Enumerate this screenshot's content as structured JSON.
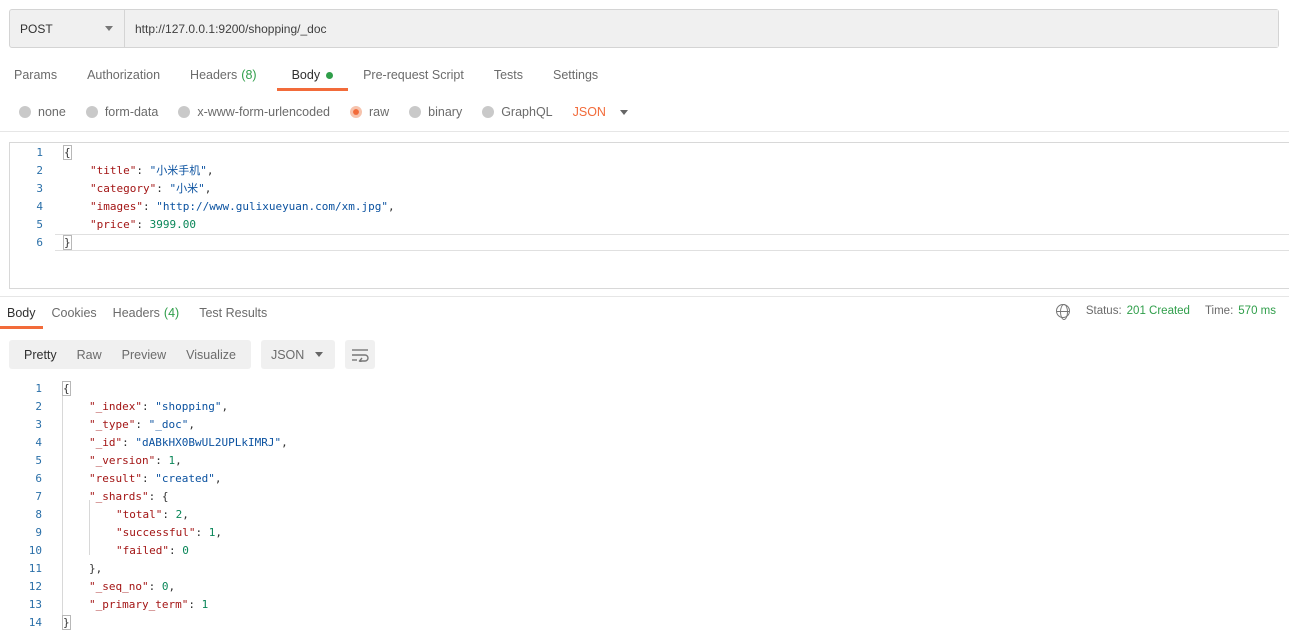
{
  "request": {
    "method": "POST",
    "url": "http://127.0.0.1:9200/shopping/_doc"
  },
  "request_tabs": [
    {
      "label": "Params",
      "count": ""
    },
    {
      "label": "Authorization",
      "count": ""
    },
    {
      "label": "Headers",
      "count": "(8)"
    },
    {
      "label": "Body",
      "count": "",
      "active": true
    },
    {
      "label": "Pre-request Script",
      "count": ""
    },
    {
      "label": "Tests",
      "count": ""
    },
    {
      "label": "Settings",
      "count": ""
    }
  ],
  "body_types": [
    "none",
    "form-data",
    "x-www-form-urlencoded",
    "raw",
    "binary",
    "GraphQL"
  ],
  "body_type_selected": "raw",
  "body_language": "JSON",
  "request_body": {
    "line_numbers": [
      "1",
      "2",
      "3",
      "4",
      "5",
      "6"
    ],
    "open_brace": "{",
    "close_brace": "}",
    "fields": [
      {
        "key": "\"title\"",
        "value": "\"小米手机\"",
        "sep": ","
      },
      {
        "key": "\"category\"",
        "value": "\"小米\"",
        "sep": ","
      },
      {
        "key": "\"images\"",
        "value": "\"http://www.gulixueyuan.com/xm.jpg\"",
        "sep": ","
      },
      {
        "key": "\"price\"",
        "value": "3999.00",
        "sep": ""
      }
    ]
  },
  "response_tabs": [
    {
      "label": "Body",
      "count": "",
      "active": true
    },
    {
      "label": "Cookies",
      "count": ""
    },
    {
      "label": "Headers",
      "count": "(4)"
    },
    {
      "label": "Test Results",
      "count": ""
    }
  ],
  "response_status": {
    "status_label": "Status:",
    "status_value": "201 Created",
    "time_label": "Time:",
    "time_value": "570 ms"
  },
  "view_modes": [
    "Pretty",
    "Raw",
    "Preview",
    "Visualize"
  ],
  "view_mode_selected": "Pretty",
  "response_format": "JSON",
  "response_body": {
    "line_numbers": [
      "1",
      "2",
      "3",
      "4",
      "5",
      "6",
      "7",
      "8",
      "9",
      "10",
      "11",
      "12",
      "13",
      "14"
    ],
    "lines": [
      {
        "indent": 0,
        "key": "",
        "value": "{",
        "sep": ""
      },
      {
        "indent": 1,
        "key": "\"_index\"",
        "value": "\"shopping\"",
        "sep": ","
      },
      {
        "indent": 1,
        "key": "\"_type\"",
        "value": "\"_doc\"",
        "sep": ","
      },
      {
        "indent": 1,
        "key": "\"_id\"",
        "value": "\"dABkHX0BwUL2UPLkIMRJ\"",
        "sep": ","
      },
      {
        "indent": 1,
        "key": "\"_version\"",
        "value": "1",
        "sep": ","
      },
      {
        "indent": 1,
        "key": "\"result\"",
        "value": "\"created\"",
        "sep": ","
      },
      {
        "indent": 1,
        "key": "\"_shards\"",
        "value": "{",
        "sep": ""
      },
      {
        "indent": 2,
        "key": "\"total\"",
        "value": "2",
        "sep": ","
      },
      {
        "indent": 2,
        "key": "\"successful\"",
        "value": "1",
        "sep": ","
      },
      {
        "indent": 2,
        "key": "\"failed\"",
        "value": "0",
        "sep": ""
      },
      {
        "indent": 1,
        "key": "",
        "value": "},",
        "sep": ""
      },
      {
        "indent": 1,
        "key": "\"_seq_no\"",
        "value": "0",
        "sep": ","
      },
      {
        "indent": 1,
        "key": "\"_primary_term\"",
        "value": "1",
        "sep": ""
      },
      {
        "indent": 0,
        "key": "",
        "value": "}",
        "sep": ""
      }
    ]
  },
  "colors": {
    "accent": "#f26b3a",
    "success": "#2f9e4a",
    "json_key": "#a31515",
    "json_string": "#0b52a0",
    "json_number": "#098658"
  },
  "icons": {
    "method_dropdown": "chevron-down-icon",
    "globe": "globe-icon",
    "wrap": "wrap-lines-icon"
  }
}
